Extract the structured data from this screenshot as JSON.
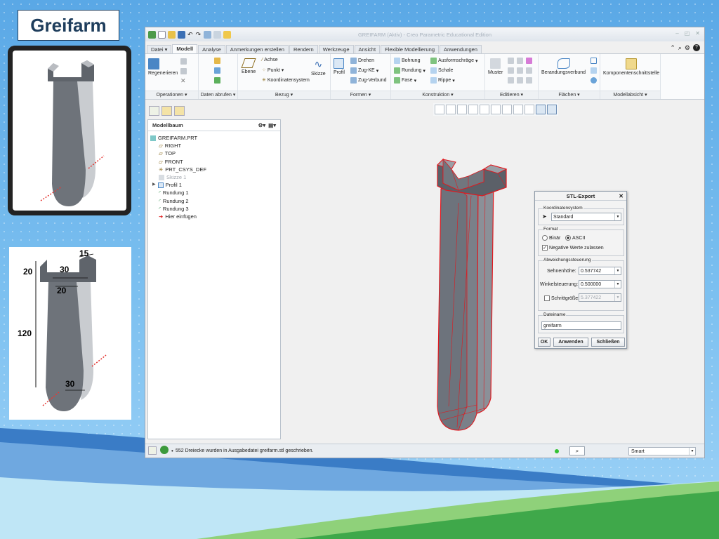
{
  "slide": {
    "title": "Greifarm",
    "dims": {
      "top_width": "15",
      "height_top": "20",
      "inner_width": "30",
      "neck": "20",
      "length": "120",
      "bottom": "30"
    }
  },
  "window": {
    "title": "GREIFARM (Aktiv) - Creo Parametric Educational Edition"
  },
  "tabs": [
    "Datei ▾",
    "Modell",
    "Analyse",
    "Anmerkungen erstellen",
    "Rendern",
    "Werkzeuge",
    "Ansicht",
    "Flexible Modellierung",
    "Anwendungen"
  ],
  "ribbon": {
    "regenerieren": "Regenerieren",
    "ebene": "Ebene",
    "achse": "Achse",
    "punkt": "Punkt",
    "koordinatensystem": "Koordinatensystem",
    "skizze": "Skizze",
    "profil": "Profil",
    "drehen": "Drehen",
    "zug_ke": "Zug-KE",
    "zug_verbund": "Zug-Verbund",
    "bohrung": "Bohrung",
    "rundung": "Rundung",
    "fase": "Fase",
    "ausformschraege": "Ausformschräge",
    "schale": "Schale",
    "rippe": "Rippe",
    "muster": "Muster",
    "berandungsverbund": "Berandungsverbund",
    "komponentenschnittstelle": "Komponentenschnittstelle",
    "groups": [
      "Operationen ▾",
      "Daten abrufen ▾",
      "Bezug ▾",
      "Formen ▾",
      "Konstruktion ▾",
      "Editieren ▾",
      "Flächen ▾",
      "Modellabsicht ▾"
    ]
  },
  "tree": {
    "header": "Modellbaum",
    "items": [
      "GREIFARM.PRT",
      "RIGHT",
      "TOP",
      "FRONT",
      "PRT_CSYS_DEF",
      "Skizze 1",
      "Profil 1",
      "Rundung 1",
      "Rundung 2",
      "Rundung 3",
      "Hier einfügen"
    ]
  },
  "dialog": {
    "title": "STL-Export",
    "koordinatensystem_label": "Koordinatensystem",
    "koordinatensystem_value": "Standard",
    "format_label": "Format",
    "binaer": "Binär",
    "ascii": "ASCII",
    "negative_werte": "Negative Werte zulassen",
    "abweichung_label": "Abweichungssteuerung",
    "sehnenhoehe_label": "Sehnenhöhe:",
    "sehnenhoehe_value": "0.537742",
    "winkelsteuerung_label": "Winkelsteuerung:",
    "winkelsteuerung_value": "0.500000",
    "schrittgroesse_label": "Schrittgröße:",
    "schrittgroesse_value": "5.377422",
    "dateiname_label": "Dateiname",
    "dateiname_value": "greifarm",
    "ok": "OK",
    "anwenden": "Anwenden",
    "schliessen": "Schließen"
  },
  "status": {
    "message": "552 Dreiecke wurden in Ausgabedatei greifarm.stl geschrieben.",
    "filter": "Smart"
  },
  "colors": {
    "mesh_red": "#e0191f",
    "part_gray": "#6d737c",
    "accent_blue": "#1e3d5c"
  }
}
